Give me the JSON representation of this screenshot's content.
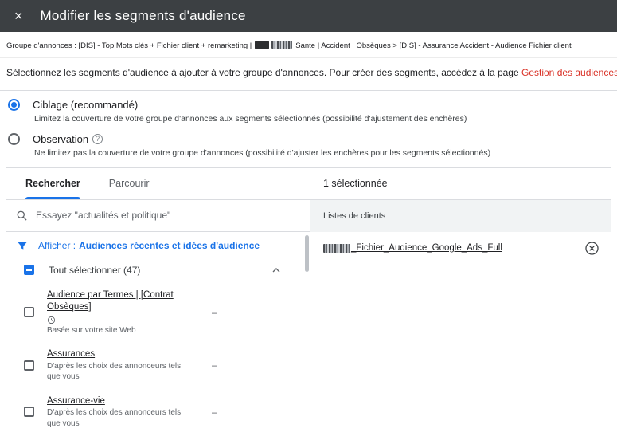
{
  "colors": {
    "topbar_bg": "#3c4043",
    "accent_blue": "#1a73e8",
    "link_red": "#d93025",
    "border_gray": "#dadce0",
    "muted_gray": "#5f6368",
    "group_band_bg": "#f1f3f4"
  },
  "icons": {
    "close": "×",
    "help": "?"
  },
  "topbar": {
    "title": "Modifier les segments d'audience"
  },
  "breadcrumb": {
    "part1": "Groupe d'annonces : [DIS] - Top Mots clés + Fichier client + remarketing |",
    "part2": "Sante | Accident | Obsèques > [DIS] - Assurance Accident - Audience Fichier client"
  },
  "intro": {
    "text": "Sélectionnez les segments d'audience à ajouter à votre groupe d'annonces. Pour créer des segments, accédez à la page ",
    "link_label": "Gestion des audiences."
  },
  "options": {
    "targeting": {
      "label": "Ciblage (recommandé)",
      "description": "Limitez la couverture de votre groupe d'annonces aux segments sélectionnés (possibilité d'ajustement des enchères)"
    },
    "observation": {
      "label": "Observation",
      "description": "Ne limitez pas la couverture de votre groupe d'annonces (possibilité d'ajuster les enchères pour les segments sélectionnés)"
    }
  },
  "panel": {
    "tabs": {
      "search": "Rechercher",
      "browse": "Parcourir"
    },
    "search_placeholder": "Essayez \"actualités et politique\"",
    "filter": {
      "prefix": "Afficher :",
      "value": "Audiences récentes et idées d'audience"
    },
    "select_all": "Tout sélectionner (47)",
    "items": [
      {
        "title": "Audience par Termes | [Contrat Obsèques]",
        "source": "Basée sur votre site Web",
        "metric": "–"
      },
      {
        "title": "Assurances",
        "source": "D'après les choix des annonceurs tels que vous",
        "metric": "–"
      },
      {
        "title": "Assurance-vie",
        "source": "D'après les choix des annonceurs tels que vous",
        "metric": "–"
      }
    ]
  },
  "selected": {
    "header": "1 sélectionnée",
    "group": "Listes de clients",
    "items": [
      {
        "name": "_Fichier_Audience_Google_Ads_Full"
      }
    ]
  }
}
